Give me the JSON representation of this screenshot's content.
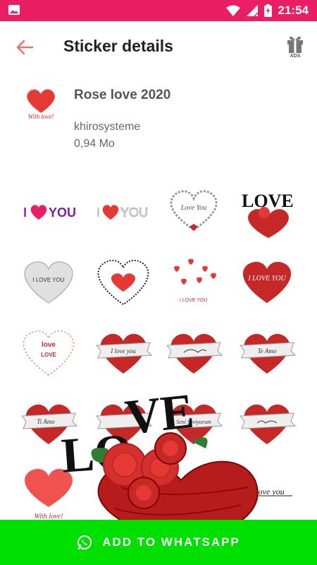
{
  "status_bar": {
    "time": "21:54"
  },
  "app_bar": {
    "title": "Sticker details",
    "ads_label": "ADS"
  },
  "pack": {
    "name": "Rose love 2020",
    "author": "khirosysteme",
    "size": "0,94 Mo"
  },
  "stickers": [
    {
      "caption": "I ♥ YOU"
    },
    {
      "caption": "I ♥ YOU"
    },
    {
      "caption": "Love You"
    },
    {
      "caption": "LOVE"
    },
    {
      "caption": "I LOVE YOU"
    },
    {
      "caption": "I love you"
    },
    {
      "caption": "I LOVE YOU"
    },
    {
      "caption": "I LOVE YOU"
    },
    {
      "caption": "love"
    },
    {
      "caption": "I love you"
    },
    {
      "caption": ""
    },
    {
      "caption": "Te Amo"
    },
    {
      "caption": "Ti Amo"
    },
    {
      "caption": ""
    },
    {
      "caption": "Seni Seviyorum"
    },
    {
      "caption": ""
    },
    {
      "caption": "With love!"
    },
    {
      "caption": ""
    },
    {
      "caption": ""
    },
    {
      "caption": "i love you"
    }
  ],
  "overlay": {
    "caption": "LOVE"
  },
  "add_button": {
    "label": "ADD TO WHATSAPP"
  },
  "colors": {
    "status_bar": "#e91e63",
    "accent": "#e57373",
    "button": "#00e000",
    "heart": "#d0121b"
  }
}
